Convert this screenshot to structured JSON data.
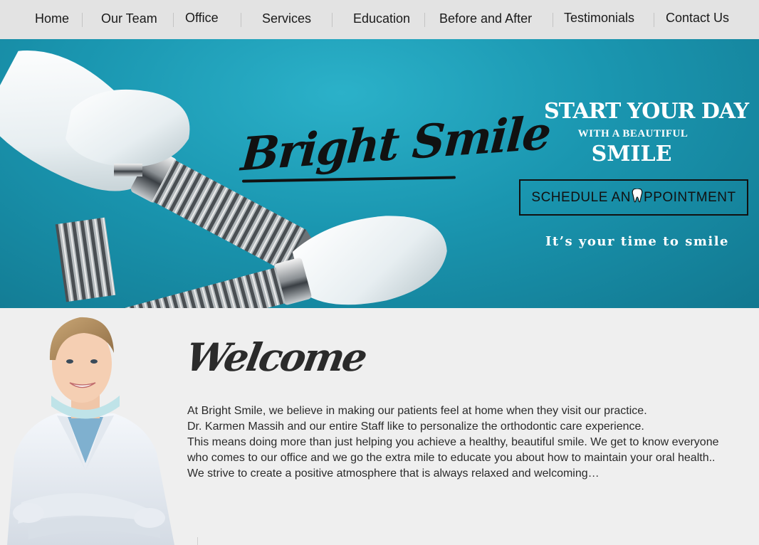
{
  "nav": {
    "items": [
      {
        "label": "Home"
      },
      {
        "label": "Our Team"
      },
      {
        "label": "Office"
      },
      {
        "label": "Services"
      },
      {
        "label": "Education"
      },
      {
        "label": "Before and After"
      },
      {
        "label": "Testimonials"
      },
      {
        "label": "Contact Us"
      }
    ]
  },
  "hero": {
    "logo": "Bright Smile",
    "headline_1": "START YOUR DAY",
    "headline_2": "WITH A BEAUTIFUL",
    "headline_3": "SMILE",
    "cta_before": "SCHEDULE AN",
    "cta_after": "PPOINTMENT",
    "tagline": "It’s your time to smile"
  },
  "welcome": {
    "title": "Welcome",
    "paragraphs": [
      "At Bright Smile, we believe in making our patients feel at home when they visit our practice.",
      "Dr. Karmen Massih and our entire Staff like to personalize the orthodontic care experience.",
      "This means doing more than just helping you achieve a healthy, beautiful smile. We get to know everyone",
      "who comes to our office and we go the extra mile to educate you about how to maintain your oral health..",
      "We strive to create a positive atmosphere that is always relaxed and welcoming…"
    ]
  },
  "icons": [
    "tooth-icon",
    "dental-implant-illustration",
    "dentist-portrait"
  ],
  "colors": {
    "nav_bg": "#e3e3e3",
    "hero_teal": "#1a96b0",
    "text": "#2a2a2a",
    "white": "#ffffff"
  }
}
